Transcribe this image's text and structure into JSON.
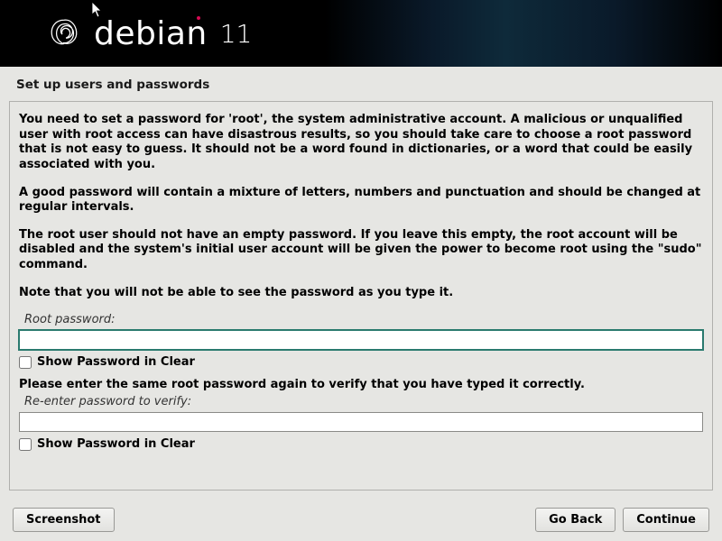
{
  "logo": {
    "text": "debian",
    "version": "11"
  },
  "title": "Set up users and passwords",
  "paragraphs": {
    "p1": "You need to set a password for 'root', the system administrative account. A malicious or unqualified user with root access can have disastrous results, so you should take care to choose a root password that is not easy to guess. It should not be a word found in dictionaries, or a word that could be easily associated with you.",
    "p2": "A good password will contain a mixture of letters, numbers and punctuation and should be changed at regular intervals.",
    "p3": "The root user should not have an empty password. If you leave this empty, the root account will be disabled and the system's initial user account will be given the power to become root using the \"sudo\" command.",
    "p4": "Note that you will not be able to see the password as you type it."
  },
  "fields": {
    "root_password_label": "Root password:",
    "root_password_value": "",
    "show_password_1": "Show Password in Clear",
    "verify_prompt": "Please enter the same root password again to verify that you have typed it correctly.",
    "verify_label": "Re-enter password to verify:",
    "verify_value": "",
    "show_password_2": "Show Password in Clear"
  },
  "buttons": {
    "screenshot": "Screenshot",
    "go_back": "Go Back",
    "continue": "Continue"
  }
}
